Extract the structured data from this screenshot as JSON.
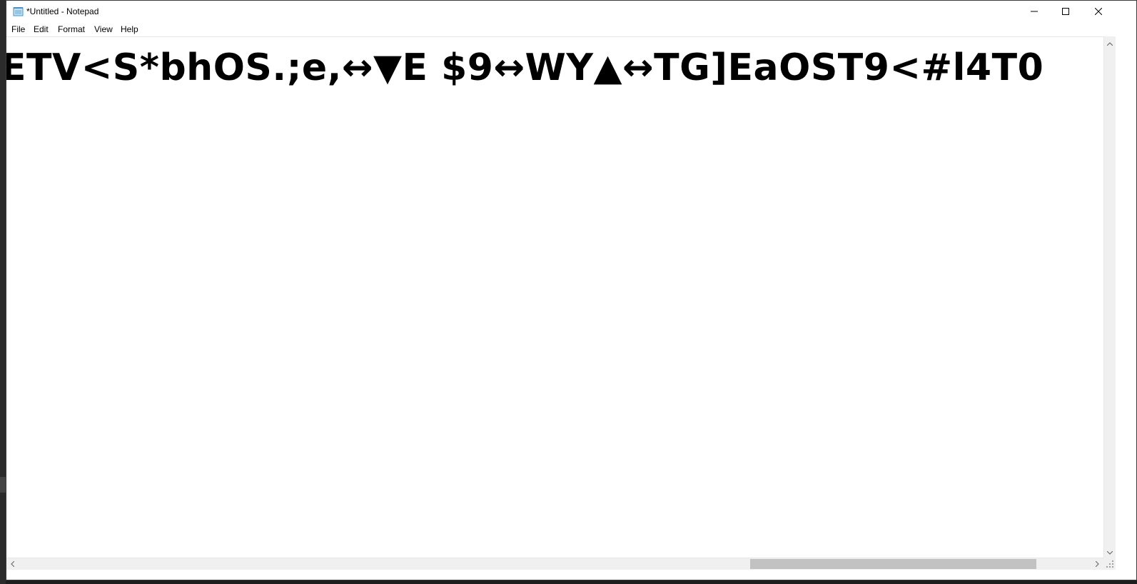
{
  "window": {
    "title": "*Untitled - Notepad",
    "icon": "notepad-icon"
  },
  "caption_buttons": {
    "minimize_icon": "minimize-icon",
    "maximize_icon": "maximize-icon",
    "close_icon": "close-icon"
  },
  "menu": {
    "items": [
      {
        "label": "File"
      },
      {
        "label": "Edit"
      },
      {
        "label": "Format"
      },
      {
        "label": "View"
      },
      {
        "label": "Help"
      }
    ]
  },
  "editor": {
    "content": "ETV<S*bhOS.;e,↔▼E $9↔WY▲↔TG]EaOST9<#l4T0"
  },
  "scrollbars": {
    "horizontal_position": 0.68,
    "up_icon": "chevron-up-icon",
    "down_icon": "chevron-down-icon",
    "left_icon": "chevron-left-icon",
    "right_icon": "chevron-right-icon"
  },
  "colors": {
    "window_bg": "#ffffff",
    "scroll_track": "#f0f0f0",
    "scroll_thumb": "#c2c2c2",
    "desktop_bg": "#1e1e1e"
  }
}
